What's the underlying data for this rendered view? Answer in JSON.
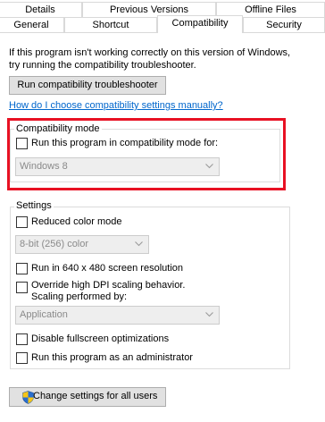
{
  "tabs": {
    "row1": [
      "Details",
      "Previous Versions",
      "Offline Files"
    ],
    "row2": [
      "General",
      "Shortcut",
      "Compatibility",
      "Security"
    ],
    "active": "Compatibility"
  },
  "intro": {
    "line1": "If this program isn't working correctly on this version of Windows,",
    "line2": "try running the compatibility troubleshooter."
  },
  "troubleshooter_button": "Run compatibility troubleshooter",
  "manual_link": "How do I choose compatibility settings manually?",
  "compat_mode": {
    "title": "Compatibility mode",
    "checkbox_label": "Run this program in compatibility mode for:",
    "checked": false,
    "select_value": "Windows 8"
  },
  "settings": {
    "title": "Settings",
    "reduced_color": "Reduced color mode",
    "color_select": "8-bit (256) color",
    "resolution": "Run in 640 x 480 screen resolution",
    "dpi_line1": "Override high DPI scaling behavior.",
    "dpi_line2": "Scaling performed by:",
    "dpi_select": "Application",
    "fullscreen": "Disable fullscreen optimizations",
    "admin": "Run this program as an administrator"
  },
  "all_users_button": "Change settings for all users",
  "colors": {
    "highlight_border": "#e81123",
    "link": "#0066cc"
  }
}
